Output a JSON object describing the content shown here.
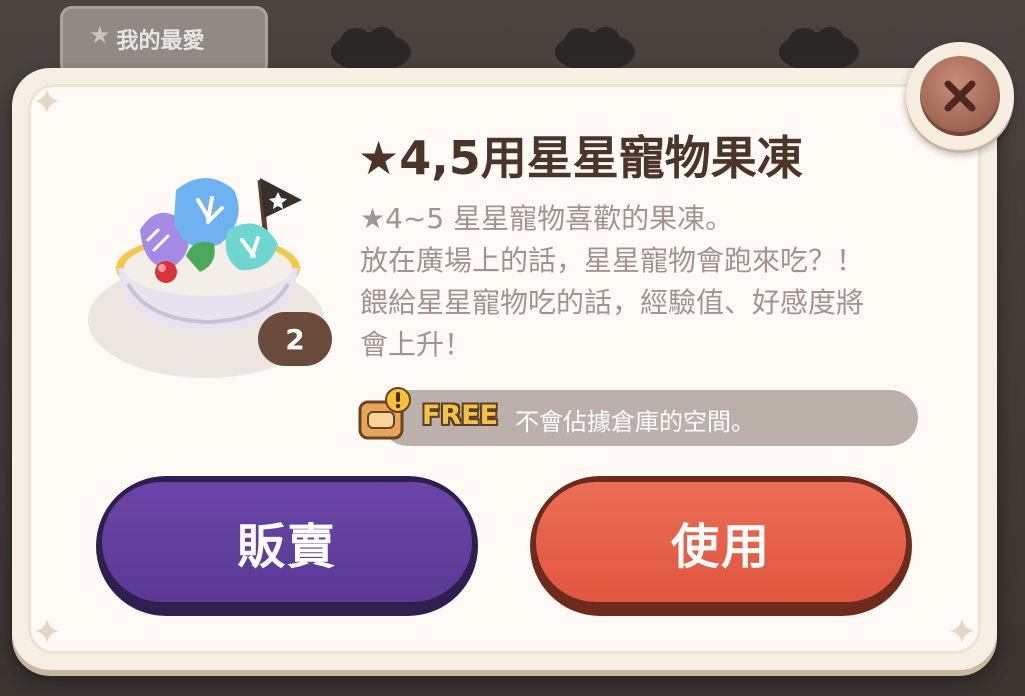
{
  "background": {
    "favorites_tab_label": "我的最愛"
  },
  "popup": {
    "item_title": "★4,5用星星寵物果凍",
    "description_lines": [
      "★4~5 星星寵物喜歡的果凍。",
      "放在廣場上的話，星星寵物會跑來吃？！",
      "餵給星星寵物吃的話，經驗值、好感度將",
      "會上升！"
    ],
    "item_count": "2",
    "free_badge": "FREE",
    "free_note": "不會佔據倉庫的空間。",
    "sell_button": "販賣",
    "use_button": "使用"
  },
  "colors": {
    "sell_button": "#5a3a94",
    "use_button": "#e0563f",
    "title_text": "#4a3528",
    "description_text": "#a39390"
  },
  "icons": {
    "close": "close-icon",
    "favorite": "star-icon",
    "free_storage": "storage-notice-icon"
  }
}
